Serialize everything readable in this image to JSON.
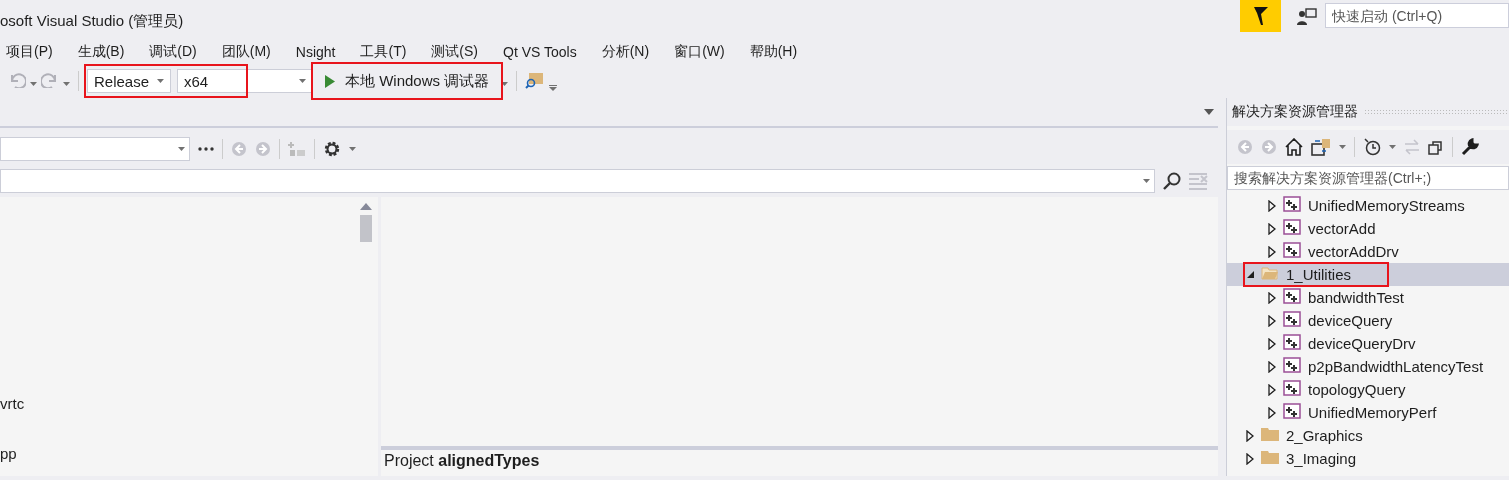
{
  "window": {
    "title": "osoft Visual Studio (管理员)"
  },
  "quick_launch": {
    "placeholder": "快速启动 (Ctrl+Q)"
  },
  "menu": [
    "项目(P)",
    "生成(B)",
    "调试(D)",
    "团队(M)",
    "Nsight",
    "工具(T)",
    "测试(S)",
    "Qt VS Tools",
    "分析(N)",
    "窗口(W)",
    "帮助(H)"
  ],
  "toolbar": {
    "configuration": "Release",
    "platform": "x64",
    "config_highlighted": true,
    "run_button": {
      "label": "本地 Windows 调试器",
      "highlighted": true
    }
  },
  "left_pane": {
    "lines": [
      "vrtc",
      "pp"
    ]
  },
  "detail_pane": {
    "heading": "Project **alignedTypes**"
  },
  "solution_explorer": {
    "title": "解决方案资源管理器",
    "search": {
      "placeholder": "搜索解决方案资源管理器(Ctrl+;)"
    },
    "tree": [
      {
        "kind": "continuation",
        "children": [
          {
            "kind": "project",
            "label": "UnifiedMemoryStreams",
            "expanded": false,
            "selected": false,
            "highlighted": false
          },
          {
            "kind": "project",
            "label": "vectorAdd",
            "expanded": false,
            "selected": false,
            "highlighted": false
          },
          {
            "kind": "project",
            "label": "vectorAddDrv",
            "expanded": false,
            "selected": false,
            "highlighted": false
          }
        ]
      },
      {
        "kind": "folder",
        "label": "1_Utilities",
        "expanded": true,
        "selected": true,
        "highlighted": true,
        "children": [
          {
            "kind": "project",
            "label": "bandwidthTest",
            "expanded": false,
            "selected": false,
            "highlighted": false
          },
          {
            "kind": "project",
            "label": "deviceQuery",
            "expanded": false,
            "selected": false,
            "highlighted": false
          },
          {
            "kind": "project",
            "label": "deviceQueryDrv",
            "expanded": false,
            "selected": false,
            "highlighted": false
          },
          {
            "kind": "project",
            "label": "p2pBandwidthLatencyTest",
            "expanded": false,
            "selected": false,
            "highlighted": false
          },
          {
            "kind": "project",
            "label": "topologyQuery",
            "expanded": false,
            "selected": false,
            "highlighted": false
          },
          {
            "kind": "project",
            "label": "UnifiedMemoryPerf",
            "expanded": false,
            "selected": false,
            "highlighted": false
          }
        ]
      },
      {
        "kind": "folder",
        "label": "2_Graphics",
        "expanded": false,
        "selected": false,
        "highlighted": false
      },
      {
        "kind": "folder",
        "label": "3_Imaging",
        "expanded": false,
        "selected": false,
        "highlighted": false
      }
    ]
  }
}
